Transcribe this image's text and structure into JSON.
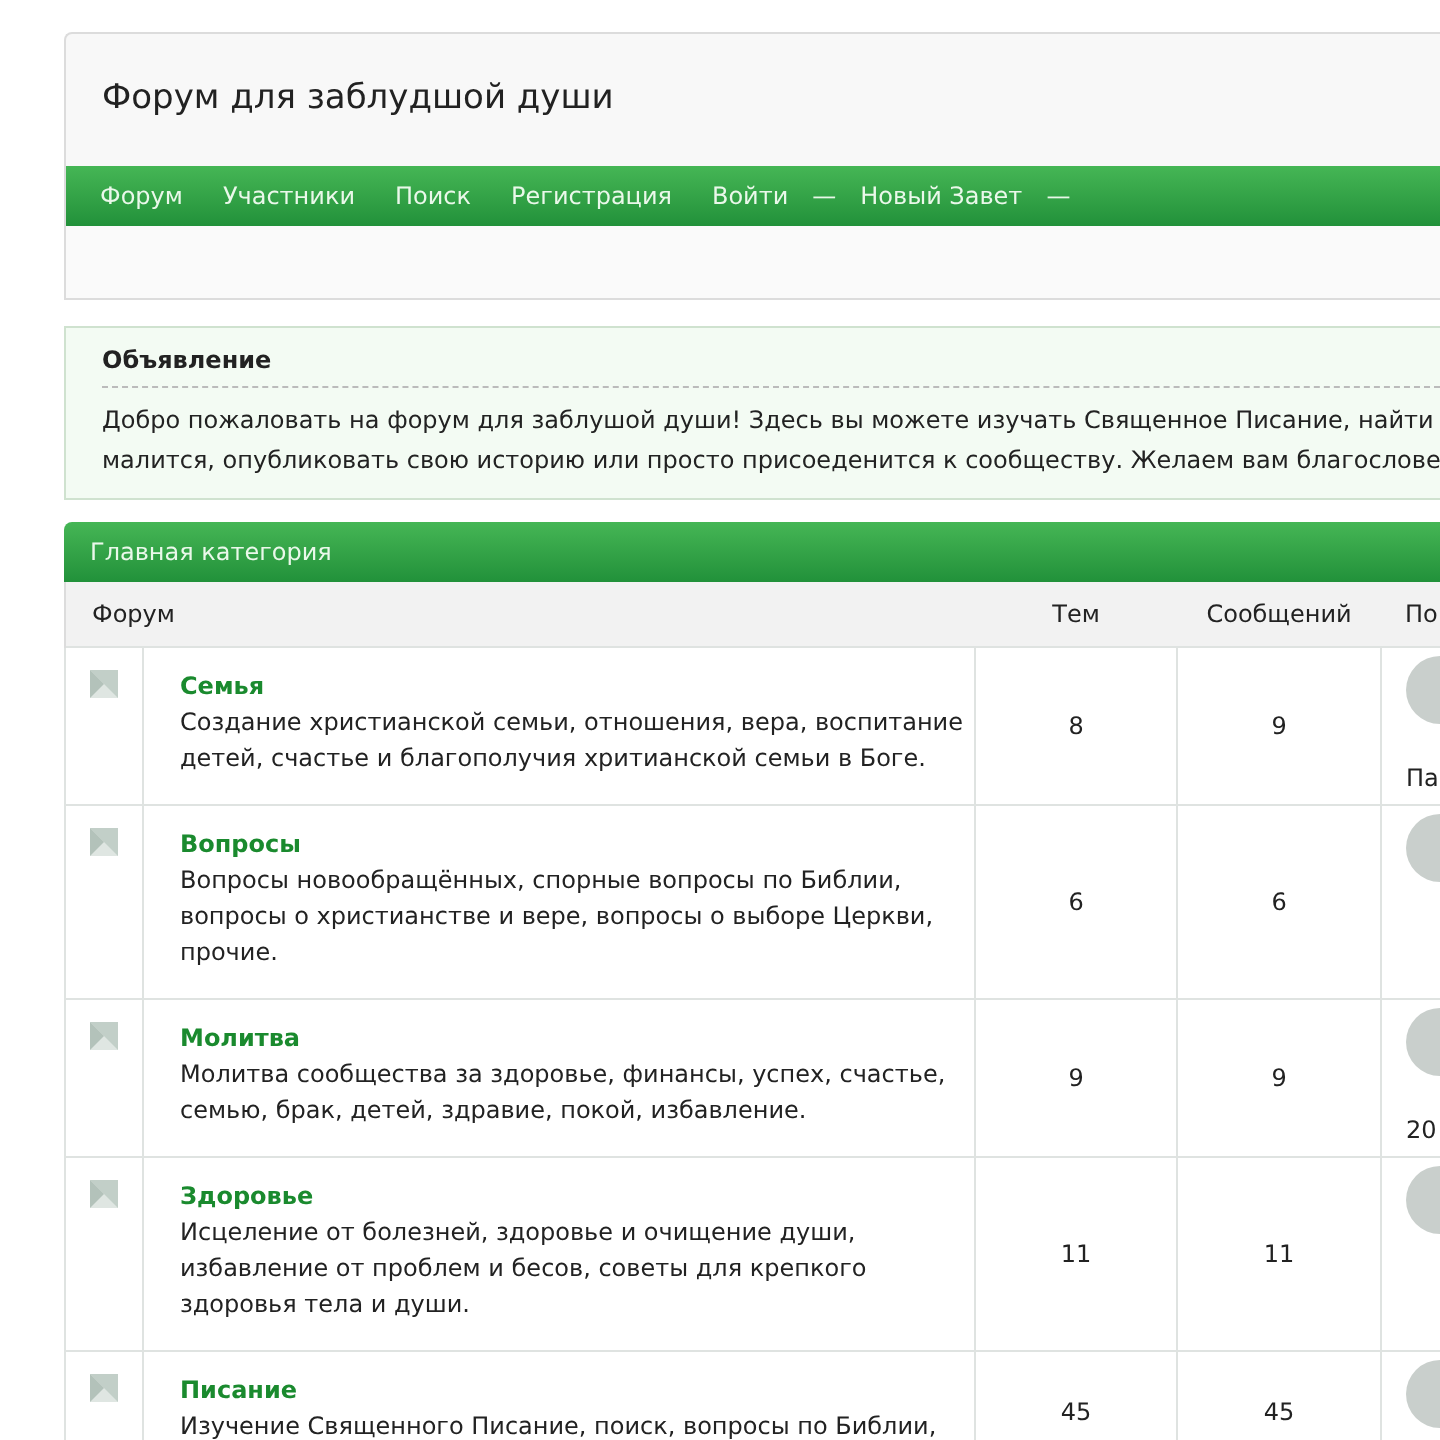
{
  "site_title": "Форум для заблудшой души",
  "nav": [
    {
      "label": "Форум"
    },
    {
      "label": "Участники"
    },
    {
      "label": "Поиск"
    },
    {
      "label": "Регистрация"
    },
    {
      "label": "Войти"
    },
    {
      "label": "—",
      "kind": "separator"
    },
    {
      "label": "Новый Завет"
    },
    {
      "label": "—",
      "kind": "separator"
    }
  ],
  "announcement": {
    "title": "Объявление",
    "lines": [
      "Добро пожаловать на форум для заблушой души! Здесь вы можете изучать Священное Писание, найти",
      "малится, опубликовать свою историю или просто присоеденится к сообществу. Желаем вам благослове"
    ]
  },
  "category": {
    "title": "Главная категория",
    "columns": [
      "Форум",
      "Тем",
      "Сообщений",
      "По"
    ],
    "rows": [
      {
        "name": "Семья",
        "description": "Создание христианской семьи, отношения, вера, воспитание детей, счастье и благополучия хритианской семьи в Боге.",
        "topics": "8",
        "posts": "9",
        "last": "Па"
      },
      {
        "name": "Вопросы",
        "description": "Вопросы новообращённых, спорные вопросы по Библии, вопросы о христианстве и вере, вопросы о выборе Церкви, прочие.",
        "topics": "6",
        "posts": "6"
      },
      {
        "name": "Молитва",
        "description": "Молитва сообщества за здоровье, финансы, успех, счастье, семью, брак, детей, здравие, покой, избавление.",
        "topics": "9",
        "posts": "9",
        "last": "20"
      },
      {
        "name": "Здоровье",
        "description": "Исцеление от болезней, здоровье и очищение души, избавление от проблем и бесов, советы для крепкого здоровья тела и души.",
        "topics": "11",
        "posts": "11"
      },
      {
        "name": "Писание",
        "description": "Изучение Священного Писание, поиск, вопросы по Библии,",
        "topics": "45",
        "posts": "45"
      }
    ]
  }
}
